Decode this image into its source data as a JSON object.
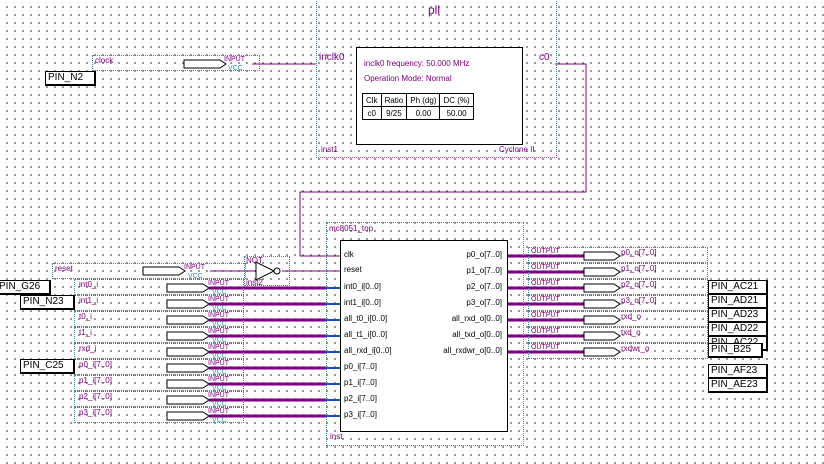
{
  "pll": {
    "title": "pll",
    "in_port": "inclk0",
    "out_port": "c0",
    "freq_line": "inclk0 frequency: 50.000 MHz",
    "mode_line": "Operation Mode: Normal",
    "table_headers": [
      "Clk",
      "Ratio",
      "Ph (dg)",
      "DC (%)"
    ],
    "table_row": [
      "c0",
      "9/25",
      "0.00",
      "50.00"
    ],
    "inst": "inst1",
    "device": "Cyclone II"
  },
  "top": {
    "title": "mc8051_top",
    "inst": "inst",
    "in_ports": [
      "clk",
      "reset",
      "int0_i[0..0]",
      "int1_i[0..0]",
      "all_t0_i[0..0]",
      "all_t1_i[0..0]",
      "all_rxd_i[0..0]",
      "p0_i[7..0]",
      "p1_i[7..0]",
      "p2_i[7..0]",
      "p3_i[7..0]"
    ],
    "out_ports": [
      "p0_o[7..0]",
      "p1_o[7..0]",
      "p2_o[7..0]",
      "p3_o[7..0]",
      "all_rxd_o[0..0]",
      "all_txd_o[0..0]",
      "all_rxdwr_o[0..0]"
    ]
  },
  "not_gate": {
    "title": "NOT",
    "inst": "inst2"
  },
  "io": {
    "input_tag": "INPUT",
    "output_tag": "OUTPUT",
    "vcc_tag": "VCC",
    "clock_name": "clock",
    "reset_name": "reset",
    "input_names": [
      "int0_i",
      "int1_i",
      "t0_i",
      "t1_i",
      "rxd_i",
      "p0_i[7..0]",
      "p1_i[7..0]",
      "p2_i[7..0]",
      "p3_i[7..0]"
    ],
    "output_names": [
      "p0_o[7..0]",
      "p1_o[7..0]",
      "p2_o[7..0]",
      "p3_o[7..0]",
      "rxd_o",
      "txd_o",
      "rxdwr_o"
    ]
  },
  "pins_left": [
    "PIN_N2",
    "PIN_G26",
    "PIN_N23",
    "PIN_C25"
  ],
  "pins_right": [
    "PIN_AC21",
    "PIN_AD21",
    "PIN_AD23",
    "PIN_AD22",
    "PIN_AC22",
    "PIN_B25",
    "PIN_AF23",
    "PIN_AE23"
  ],
  "colors": {
    "wire": "#800080",
    "bus": "#800080",
    "frame": "#3a8aa0",
    "background": "#ffffff"
  }
}
